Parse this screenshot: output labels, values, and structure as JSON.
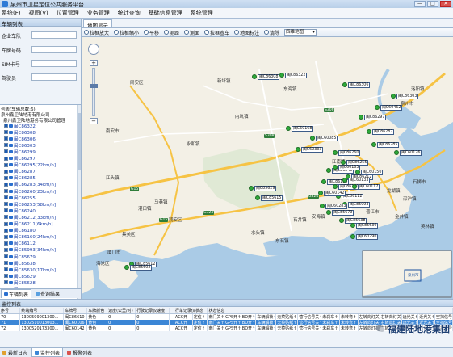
{
  "window": {
    "title": "泉州市卫星定位公共服务平台",
    "controls": {
      "minimize": "—",
      "maximize": "□",
      "close": "✕"
    }
  },
  "menubar": [
    "系统(F)",
    "视图(V)",
    "位置管理",
    "业务管理",
    "统计查询",
    "基础信息管理",
    "系统管理"
  ],
  "left_panel": {
    "title": "车辆列表",
    "fields": [
      {
        "label": "企业车队"
      },
      {
        "label": "车牌号码"
      },
      {
        "label": "SIM卡号"
      },
      {
        "label": "驾驶员"
      }
    ],
    "tree_header_1": "列表(车辆总数:6)",
    "tree_header_2": "泉州鑫卫陆地港有限公司",
    "tree_header_3": "泉州鑫卫陆地港务有限公司管理",
    "vehicles": [
      "闽C86322",
      "闽C86308",
      "闽C86306",
      "闽C86303",
      "闽C86299",
      "闽C86297",
      "闽C86295[22km/h]",
      "闽C86287",
      "闽C86285",
      "闽C86283[34km/h]",
      "闽C86260[23km/h]",
      "闽C86255",
      "闽C86253[58km/h]",
      "闽C86240",
      "闽C86212[33km/h]",
      "闽C86211[6km/h]",
      "闽C86180",
      "闽C86160[24km/h]",
      "闽C86112",
      "闽C85993[34km/h]",
      "闽C85679",
      "闽C85638",
      "闽C85630[17km/h]",
      "闽C85629",
      "闽C85628",
      "闽C85625",
      "闽C85615"
    ],
    "tabs": [
      "车辆列表",
      "查询结果"
    ]
  },
  "map_panel": {
    "tab": "地图显示",
    "toolbar": [
      "拉框放大",
      "拉框缩小",
      "平移",
      "测距",
      "测面",
      "拉框查车",
      "地图标注",
      "清除"
    ],
    "map_type": "四维地图",
    "place_labels": [
      "泉州市",
      "洛阳镇",
      "东海镇",
      "江南镇",
      "石狮市",
      "晋江市",
      "厦门市",
      "同安区",
      "马巷镇",
      "新圩镇",
      "南安市",
      "安海镇",
      "金井镇",
      "深沪镇",
      "水头镇",
      "石井镇",
      "内坑镇",
      "东石镇",
      "龙湖镇",
      "英林镇",
      "永和镇",
      "灌口镇",
      "江头镇",
      "翔安区",
      "集美区",
      "海沧区"
    ],
    "vehicle_tags": [
      "闽C86322",
      "闽C86308",
      "闽C86306",
      "闽C86303",
      "闽C86297",
      "闽C86287",
      "闽C86285",
      "闽C86260",
      "闽C86255",
      "闽C86240",
      "闽C86212",
      "闽C86180",
      "闽C86160",
      "闽C86112",
      "闽C85993",
      "闽C85679",
      "闽C85638",
      "闽C85630",
      "闽C85629",
      "闽C85615",
      "闽C85612",
      "闽C60165",
      "闽C60150",
      "闽C60142",
      "闽C60117",
      "闽C60133",
      "闽C60283",
      "闽C60290",
      "闽C60462",
      "闽C60126",
      "闽C60333",
      "闽C60085",
      "闽C85602",
      "闽C60168"
    ],
    "road_labels": [
      "G15",
      "G15",
      "G324",
      "G324",
      "S308",
      "S306"
    ],
    "inset_labels": [
      "泉州市"
    ]
  },
  "bottom_panel": {
    "title": "监控列表",
    "columns": [
      "序号",
      "终端编号",
      "车牌号",
      "车牌颜色",
      "速度(公里/时)",
      "行驶记录仪速度",
      "行车记录仪状态",
      "状态信息",
      "",
      "",
      "",
      "",
      "",
      "",
      "",
      "",
      ""
    ],
    "rows": [
      [
        "70",
        "1300599001300...",
        "闽C86610",
        "黄色",
        "0",
        "0",
        "",
        "ACC开",
        "定位↑",
        "南门关↑",
        "GPS开↑",
        "BD开↑",
        "车辆解锁↑",
        "无菜贴纸↑",
        "营行信号关↑",
        "未刹车↑",
        "未转弯↑",
        "左转向灯关↑",
        "右转向灯关↑",
        "远光关↑",
        "近光关↑",
        "空挡信号关"
      ],
      [
        "71",
        "1302510013003...",
        "闽C60106",
        "黄色",
        "0",
        "0",
        "",
        "ACC开",
        "定位↑",
        "南门关↑",
        "GPS开↑",
        "BD开↑",
        "车辆解锁↑",
        "无菜贴纸↑",
        "营行信号关↑",
        "未刹车↑",
        "未转弯↑",
        "左转向灯关↑",
        "右转向灯关↑",
        "远光关↑",
        "近光关↑",
        "空挡信号关"
      ],
      [
        "72",
        "1300520173300...",
        "闽C60142",
        "黄色",
        "0",
        "0",
        "",
        "ACC开",
        "定位↑",
        "南门关↑",
        "GPS开↑",
        "BD开↑",
        "车辆解锁↑",
        "无菜贴纸↑",
        "营行信号关↑",
        "未刹车↑",
        "未转弯↑",
        "左转向灯关↑",
        "右转向灯关↑",
        "远光关↑",
        "近光关↑",
        "空挡信号关"
      ]
    ],
    "selected_row": 1,
    "tabs": [
      "最新日志",
      "监控列表",
      "报警列表"
    ],
    "watermark": "福建陆地港集团"
  },
  "colors": {
    "selected_row": "#3b86d6",
    "vehicle_marker": "#2eaa3a",
    "tag_background": "#ffffff",
    "sea": "#aacbe6",
    "land": "#f3f0e6",
    "road_major": "#f6c344",
    "road_minor": "#ffffff"
  }
}
